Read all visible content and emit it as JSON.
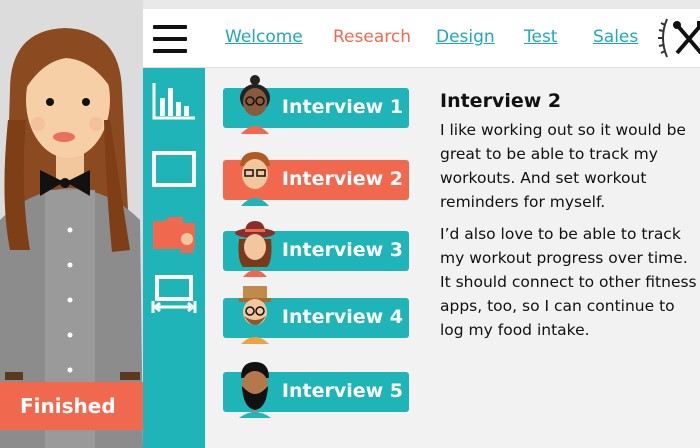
{
  "nav": {
    "links": [
      "Welcome",
      "Research",
      "Design",
      "Test",
      "Sales"
    ],
    "active": "Research"
  },
  "tools": [
    "bar-chart-icon",
    "canvas-icon",
    "persona-folder-icon",
    "dimensions-icon"
  ],
  "interviews": [
    {
      "label": "Interview 1",
      "avatar": "avatar-woman-glasses"
    },
    {
      "label": "Interview 2",
      "avatar": "avatar-man-glasses",
      "selected": true
    },
    {
      "label": "Interview 3",
      "avatar": "avatar-woman-hat"
    },
    {
      "label": "Interview 4",
      "avatar": "avatar-man-beard-hat"
    },
    {
      "label": "Interview 5",
      "avatar": "avatar-man-beard"
    }
  ],
  "detail": {
    "title": "Interview 2",
    "paragraphs": [
      "I like working out so it would be great to be able to track my workouts. And set workout reminders for myself.",
      "I’d also love to be able to track my workout progress over time. It should connect to other fitness apps, too, so I can continue to log my food intake."
    ]
  },
  "finished_label": "Finished",
  "colors": {
    "teal": "#1fb5b8",
    "coral": "#f0694f",
    "link": "#1fa9b5"
  }
}
